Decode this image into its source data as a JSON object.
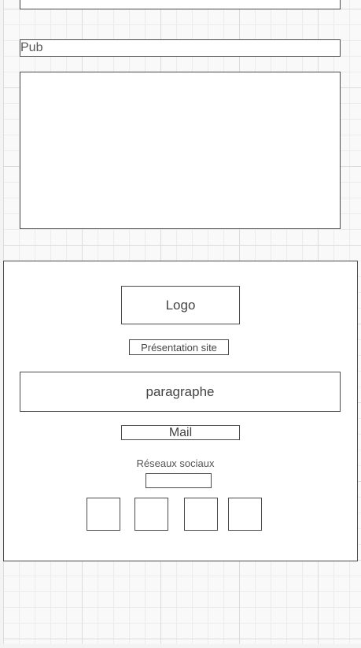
{
  "wireframe": {
    "pub_label": "Pub",
    "footer": {
      "logo_label": "Logo",
      "presentation_label": "Présentation site",
      "paragraph_label": "paragraphe",
      "mail_label": "Mail",
      "social_title": "Réseaux sociaux",
      "social_icon_count": 4
    }
  }
}
